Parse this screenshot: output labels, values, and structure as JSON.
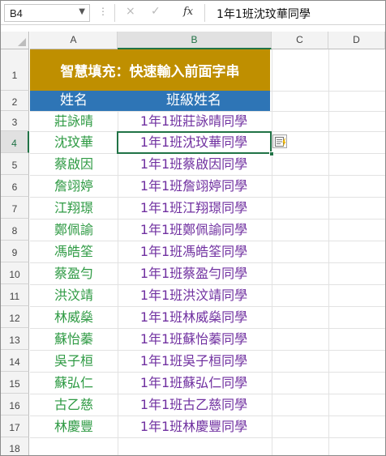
{
  "formula_bar": {
    "name_box": "B4",
    "cancel_icon": "×",
    "enter_icon": "✓",
    "fx_label": "fx",
    "content": "1年1班沈玟華同學"
  },
  "columns": [
    "A",
    "B",
    "C",
    "D"
  ],
  "selected_column": "B",
  "rows": [
    "1",
    "2",
    "3",
    "4",
    "5",
    "6",
    "7",
    "8",
    "9",
    "10",
    "11",
    "12",
    "13",
    "14",
    "15",
    "16",
    "17",
    "18"
  ],
  "selected_row": "4",
  "sheet": {
    "title": "智慧填充：快速輸入前面字串",
    "header_name": "姓名",
    "header_class_name": "班級姓名",
    "names": [
      "莊詠晴",
      "沈玟華",
      "蔡啟因",
      "詹翊婷",
      "江翔璟",
      "鄭佩諭",
      "馮皓筌",
      "蔡盈勻",
      "洪汶靖",
      "林威燊",
      "蘇怡蓁",
      "吳子桓",
      "蘇弘仁",
      "古乙慈",
      "林慶豐"
    ],
    "class_names": [
      "1年1班莊詠晴同學",
      "1年1班沈玟華同學",
      "1年1班蔡啟因同學",
      "1年1班詹翊婷同學",
      "1年1班江翔璟同學",
      "1年1班鄭佩諭同學",
      "1年1班馮皓筌同學",
      "1年1班蔡盈勻同學",
      "1年1班洪汶靖同學",
      "1年1班林威燊同學",
      "1年1班蘇怡蓁同學",
      "1年1班吳子桓同學",
      "1年1班蘇弘仁同學",
      "1年1班古乙慈同學",
      "1年1班林慶豐同學"
    ]
  },
  "colors": {
    "title_bg": "#bf8f00",
    "header_bg": "#2e75b6",
    "name_text": "#2e9a43",
    "class_text": "#7030a0",
    "selection": "#217346"
  },
  "icons": [
    "dropdown-arrow-icon",
    "cancel-icon",
    "enter-icon",
    "function-icon",
    "flash-fill-options-icon",
    "select-all-icon"
  ]
}
